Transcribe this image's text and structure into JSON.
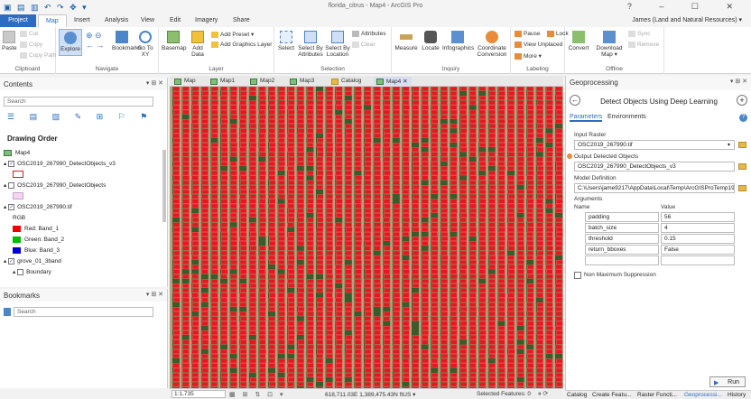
{
  "titlebar": {
    "title": "florida_citrus - Map4 - ArcGIS Pro",
    "controls": "? – ☐ ✕"
  },
  "tabs": [
    {
      "label": "Project"
    },
    {
      "label": "Map"
    },
    {
      "label": "Insert"
    },
    {
      "label": "Analysis"
    },
    {
      "label": "View"
    },
    {
      "label": "Edit"
    },
    {
      "label": "Imagery"
    },
    {
      "label": "Share"
    }
  ],
  "user": "James (Land and Natural Resources) ▾",
  "ribbon": {
    "clipboard": {
      "label": "Clipboard",
      "paste": "Paste",
      "cut": "Cut",
      "copy": "Copy",
      "copy_path": "Copy Path"
    },
    "navigate": {
      "label": "Navigate",
      "explore": "Explore",
      "bookmarks": "Bookmarks",
      "goto": "Go To XY"
    },
    "layer": {
      "label": "Layer",
      "basemap": "Basemap",
      "add_data": "Add Data",
      "add_preset": "Add Preset ▾",
      "add_graphics": "Add Graphics Layer"
    },
    "selection": {
      "label": "Selection",
      "select": "Select",
      "select_attr": "Select By Attributes",
      "select_loc": "Select By Location",
      "attributes": "Attributes",
      "clear": "Clear"
    },
    "inquiry": {
      "label": "Inquiry",
      "measure": "Measure",
      "locate": "Locate",
      "infographics": "Infographics",
      "coord": "Coordinate Conversion"
    },
    "labeling": {
      "label": "Labeling",
      "pause": "Pause",
      "lock": "Lock",
      "view_unplaced": "View Unplaced",
      "more": "More ▾"
    },
    "offline": {
      "label": "Offline",
      "convert": "Convert",
      "download": "Download Map ▾",
      "sync": "Sync",
      "remove": "Remove"
    }
  },
  "contents": {
    "title": "Contents",
    "search_placeholder": "Search",
    "drawing_order": "Drawing Order",
    "layers": [
      {
        "name": "Map4"
      },
      {
        "name": "OSC2019_267990_DetectObjects_v3"
      },
      {
        "name": "OSC2019_267990_DetectObjects"
      },
      {
        "name": "OSC2019_267990.tif"
      },
      {
        "name": "RGB"
      },
      {
        "name": "Red:  Band_1"
      },
      {
        "name": "Green: Band_2"
      },
      {
        "name": "Blue:  Band_3"
      },
      {
        "name": "grove_01_3band"
      },
      {
        "name": "Boundary"
      }
    ]
  },
  "bookmarks": {
    "title": "Bookmarks",
    "search_placeholder": "Search"
  },
  "map_tabs": [
    {
      "label": "Map"
    },
    {
      "label": "Map1"
    },
    {
      "label": "Map2"
    },
    {
      "label": "Map3"
    },
    {
      "label": "Catalog"
    },
    {
      "label": "Map4"
    }
  ],
  "status": {
    "scale": "1:1,735",
    "coords": "618,711.03E 1,389,475.43N ftUS ▾",
    "selected": "Selected Features: 0"
  },
  "geo": {
    "title": "Geoprocessing",
    "tool": "Detect Objects Using Deep Learning",
    "tab_params": "Parameters",
    "tab_env": "Environments",
    "input_raster_label": "Input Raster",
    "input_raster": "OSC2019_267990.tif",
    "output_label": "Output Detected Objects",
    "output": "OSC2019_267990_DetectObjects_v3",
    "model_label": "Model Definition",
    "model": "C:\\Users\\jame9217\\AppData\\Local\\Temp\\ArcGISProTemp19",
    "arguments_label": "Arguments",
    "col_name": "Name",
    "col_value": "Value",
    "args": [
      {
        "name": "padding",
        "value": "56"
      },
      {
        "name": "batch_size",
        "value": "4"
      },
      {
        "name": "threshold",
        "value": "0.15"
      },
      {
        "name": "return_bboxes",
        "value": "False"
      },
      {
        "name": "",
        "value": ""
      }
    ],
    "nms": "Non Maximum Suppression",
    "run": "Run",
    "bottom_tabs": [
      {
        "label": "Catalog"
      },
      {
        "label": "Create Featu..."
      },
      {
        "label": "Raster Functi..."
      },
      {
        "label": "Geoprocessi..."
      },
      {
        "label": "History"
      }
    ]
  },
  "colors": {
    "accent": "#2d6cc0",
    "detection": "#e8161e",
    "ground": "#b2a27e"
  }
}
